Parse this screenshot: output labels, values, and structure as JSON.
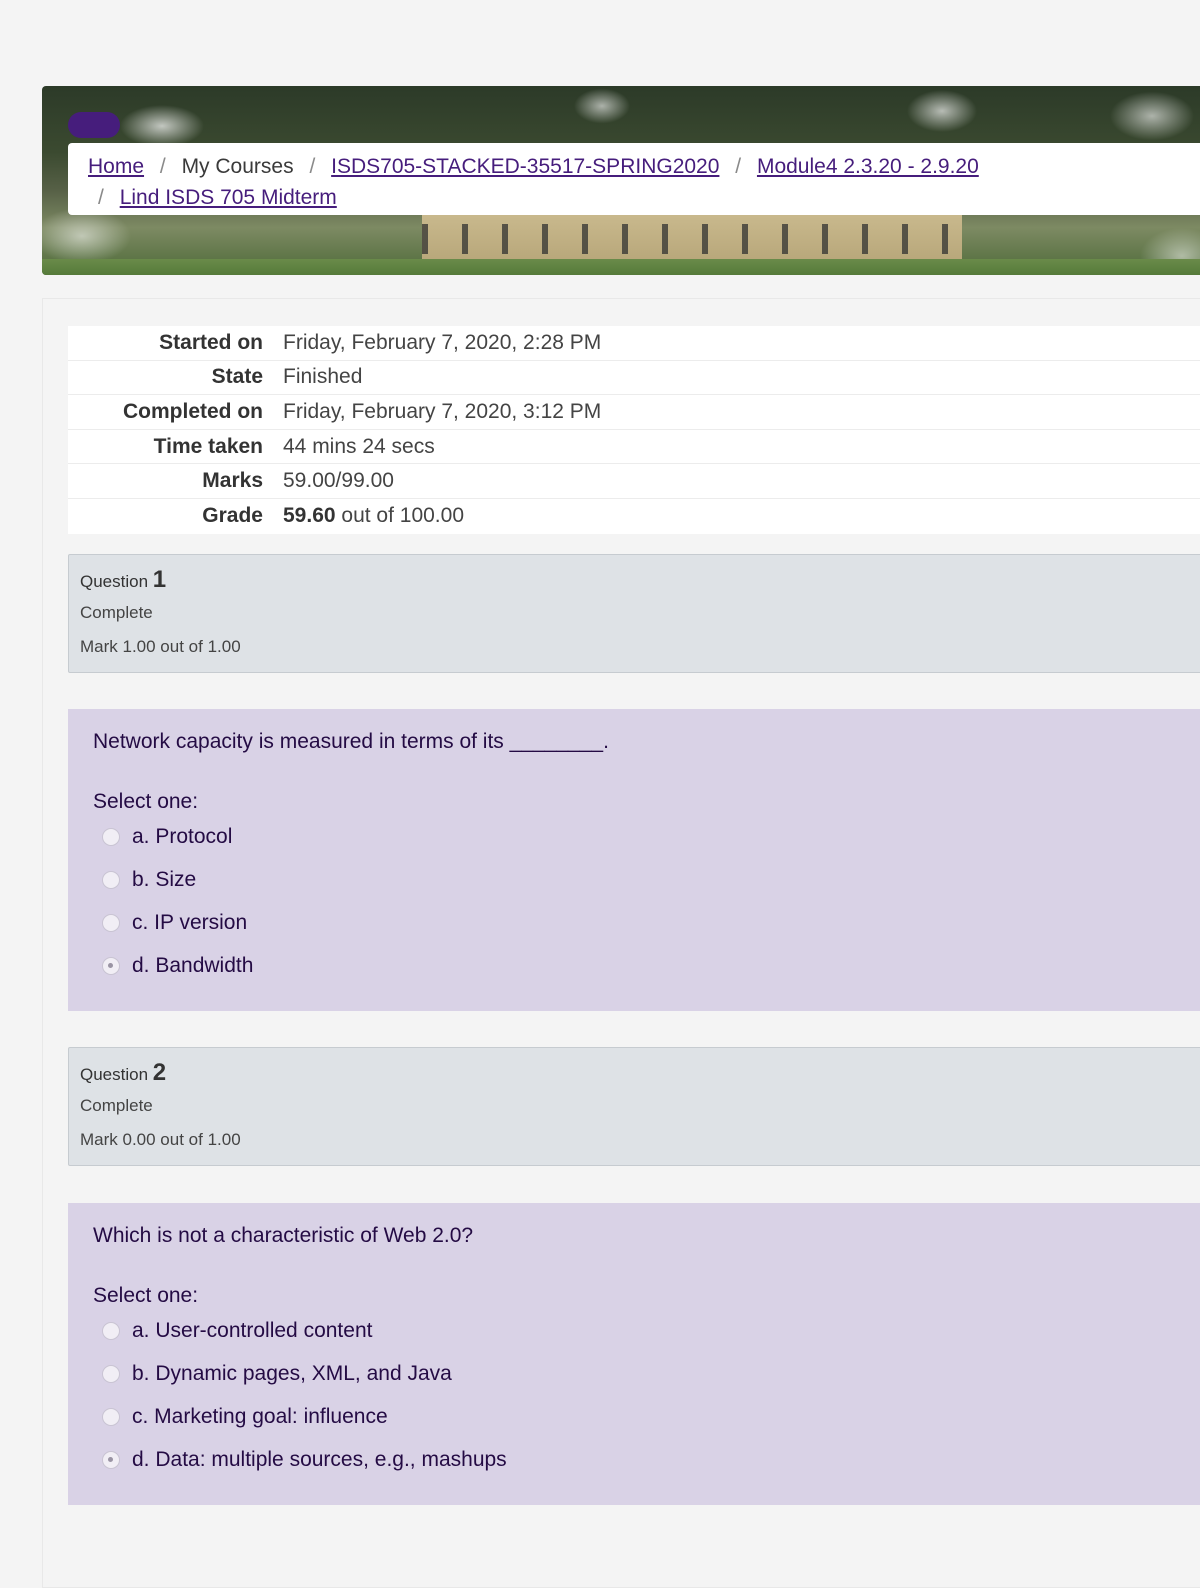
{
  "breadcrumb": {
    "home": "Home",
    "my_courses": "My Courses",
    "course": "ISDS705-STACKED-35517-SPRING2020",
    "module": "Module4 2.3.20 - 2.9.20",
    "quiz": "Lind ISDS 705 Midterm",
    "separator": "/"
  },
  "summary": [
    {
      "label": "Started on",
      "value": "Friday, February 7, 2020, 2:28 PM"
    },
    {
      "label": "State",
      "value": "Finished"
    },
    {
      "label": "Completed on",
      "value": "Friday, February 7, 2020, 3:12 PM"
    },
    {
      "label": "Time taken",
      "value": "44 mins 24 secs"
    },
    {
      "label": "Marks",
      "value": "59.00/99.00"
    },
    {
      "label": "Grade",
      "value_bold": "59.60",
      "value_rest": " out of 100.00"
    }
  ],
  "questions": [
    {
      "label": "Question",
      "number": "1",
      "state": "Complete",
      "mark": "Mark 1.00 out of 1.00",
      "text": "Network capacity is measured in terms of its ________.",
      "prompt": "Select one:",
      "options": [
        {
          "text": "a. Protocol",
          "selected": false
        },
        {
          "text": "b. Size",
          "selected": false
        },
        {
          "text": "c. IP version",
          "selected": false
        },
        {
          "text": "d. Bandwidth",
          "selected": true
        }
      ]
    },
    {
      "label": "Question",
      "number": "2",
      "state": "Complete",
      "mark": "Mark 0.00 out of 1.00",
      "text": "Which is not a characteristic of Web 2.0?",
      "prompt": "Select one:",
      "options": [
        {
          "text": "a. User-controlled content",
          "selected": false
        },
        {
          "text": "b. Dynamic pages, XML, and Java",
          "selected": false
        },
        {
          "text": "c. Marketing goal: influence",
          "selected": false
        },
        {
          "text": "d. Data: multiple sources, e.g., mashups",
          "selected": true
        }
      ]
    }
  ],
  "colors": {
    "brand_purple": "#461d7c",
    "question_body_bg": "#d9d2e6",
    "question_info_bg": "#dee2e6"
  }
}
